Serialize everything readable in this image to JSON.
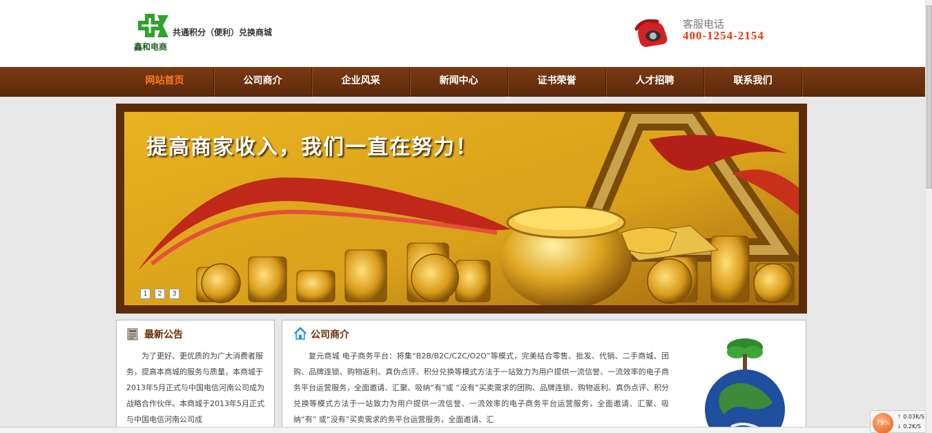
{
  "header": {
    "logo_name": "鑫和电商",
    "slogan": "共通积分（便利）兑换商城",
    "hotline_label": "客服电话",
    "hotline_number": "400-1254-2154"
  },
  "nav": {
    "items": [
      {
        "label": "网站首页",
        "active": true
      },
      {
        "label": "公司商介"
      },
      {
        "label": "企业风采"
      },
      {
        "label": "新闻中心"
      },
      {
        "label": "证书荣誉"
      },
      {
        "label": "人才招聘"
      },
      {
        "label": "联系我们"
      }
    ],
    "active_color": "#ff7a1a"
  },
  "banner": {
    "slogan": "提高商家收入，我们一直在努力！",
    "slides": [
      "1",
      "2",
      "3"
    ]
  },
  "notice": {
    "title": "最新公告",
    "text": "为了更好、更优质的为广大消费者服务，提高本商城的服务与质量，本商城于2013年5月正式与中国电信河南公司成为战略合作伙伴。本商城于2013年5月正式与中国电信河南公司成"
  },
  "about": {
    "title": "公司商介",
    "text": "复元商城 电子商务平台：将集“B2B/B2C/C2C/O2O”等模式，完美结合零售、批发、代销、二手商城、团购、品牌连锁、购物返利、真伪点评、积分兑换等模式方法于一站致力为用户提供一流信誉、一流效率的电子商务平台运营服务，全面邀请、汇聚、吸纳“有”或 “没有”买卖需求的团购、品牌连锁、购物返利、真伪点评、积分兑换等模式方法于一站致力为用户提供一流信誉、一流效率的电子商务平台运营服务，全面邀请、汇聚、吸纳“有” 或“没有”买卖需求的务平台运营服务，全面邀请、汇"
  },
  "netwidget": {
    "cpu": "79%",
    "up": "0.03K/S",
    "down": "0.2K/S"
  },
  "colors": {
    "nav_brown": "#6b3010",
    "banner_frame": "#5d2c0a",
    "accent_orange": "#e23a0a",
    "title_brown": "#6b2b00"
  }
}
